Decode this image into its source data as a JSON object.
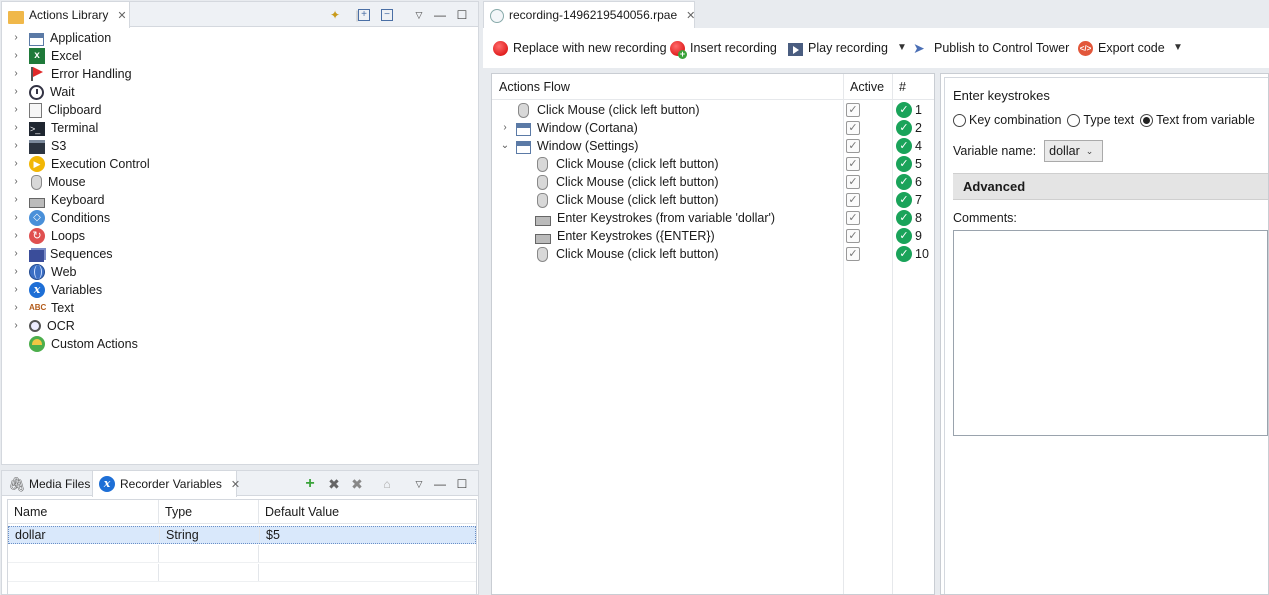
{
  "actions_library": {
    "tab_label": "Actions Library",
    "items": [
      {
        "label": "Application",
        "icon": "application-icon",
        "expandable": true
      },
      {
        "label": "Excel",
        "icon": "excel-icon",
        "expandable": true
      },
      {
        "label": "Error Handling",
        "icon": "error-flag-icon",
        "expandable": true
      },
      {
        "label": "Wait",
        "icon": "clock-icon",
        "expandable": true
      },
      {
        "label": "Clipboard",
        "icon": "clipboard-icon",
        "expandable": true
      },
      {
        "label": "Terminal",
        "icon": "terminal-icon",
        "expandable": true
      },
      {
        "label": "S3",
        "icon": "s3-icon",
        "expandable": true
      },
      {
        "label": "Execution Control",
        "icon": "execution-control-icon",
        "expandable": true
      },
      {
        "label": "Mouse",
        "icon": "mouse-icon",
        "expandable": true
      },
      {
        "label": "Keyboard",
        "icon": "keyboard-icon",
        "expandable": true
      },
      {
        "label": "Conditions",
        "icon": "conditions-icon",
        "expandable": true
      },
      {
        "label": "Loops",
        "icon": "loops-icon",
        "expandable": true
      },
      {
        "label": "Sequences",
        "icon": "sequences-icon",
        "expandable": true
      },
      {
        "label": "Web",
        "icon": "web-globe-icon",
        "expandable": true
      },
      {
        "label": "Variables",
        "icon": "variables-icon",
        "expandable": true
      },
      {
        "label": "Text",
        "icon": "text-abc-icon",
        "expandable": true
      },
      {
        "label": "OCR",
        "icon": "ocr-magnifier-icon",
        "expandable": true
      },
      {
        "label": "Custom Actions",
        "icon": "custom-actions-icon",
        "expandable": false
      }
    ]
  },
  "bottom_panel": {
    "tabs": [
      {
        "label": "Media Files",
        "icon": "paperclip-icon"
      },
      {
        "label": "Recorder Variables",
        "icon": "variables-icon"
      }
    ],
    "columns": [
      "Name",
      "Type",
      "Default Value"
    ],
    "rows": [
      {
        "name": "dollar",
        "type": "String",
        "default": "$5"
      }
    ]
  },
  "editor": {
    "tab_label": "recording-1496219540056.rpae",
    "toolbar": {
      "replace": "Replace with new recording",
      "insert": "Insert recording",
      "play": "Play recording",
      "publish": "Publish to Control Tower",
      "export": "Export code"
    },
    "flow": {
      "headers": {
        "actions": "Actions Flow",
        "active": "Active",
        "number": "#"
      },
      "check_glyph": "✓",
      "rows": [
        {
          "label": "Click Mouse (click left button)",
          "icon": "mouse-icon",
          "num": "1",
          "level": 0,
          "chevron": ""
        },
        {
          "label": "Window (Cortana)",
          "icon": "window-icon",
          "num": "2",
          "level": 0,
          "chevron": "›"
        },
        {
          "label": "Window (Settings)",
          "icon": "window-icon",
          "num": "4",
          "level": 0,
          "chevron": "⌄"
        },
        {
          "label": "Click Mouse (click left button)",
          "icon": "mouse-icon",
          "num": "5",
          "level": 1,
          "chevron": ""
        },
        {
          "label": "Click Mouse (click left button)",
          "icon": "mouse-icon",
          "num": "6",
          "level": 1,
          "chevron": ""
        },
        {
          "label": "Click Mouse (click left button)",
          "icon": "mouse-icon",
          "num": "7",
          "level": 1,
          "chevron": ""
        },
        {
          "label": "Enter Keystrokes (from variable 'dollar')",
          "icon": "keyboard-icon",
          "num": "8",
          "level": 1,
          "chevron": ""
        },
        {
          "label": "Enter Keystrokes ({ENTER})",
          "icon": "keyboard-icon",
          "num": "9",
          "level": 1,
          "chevron": ""
        },
        {
          "label": "Click Mouse (click left button)",
          "icon": "mouse-icon",
          "num": "10",
          "level": 1,
          "chevron": ""
        }
      ]
    },
    "properties": {
      "title": "Enter keystrokes",
      "radio": {
        "key_combination": "Key combination",
        "type_text": "Type text",
        "text_from_variable": "Text from variable",
        "selected": "text_from_variable"
      },
      "variable_name_label": "Variable name:",
      "variable_name_value": "dollar",
      "advanced_label": "Advanced",
      "comments_label": "Comments:",
      "comments_value": ""
    }
  }
}
